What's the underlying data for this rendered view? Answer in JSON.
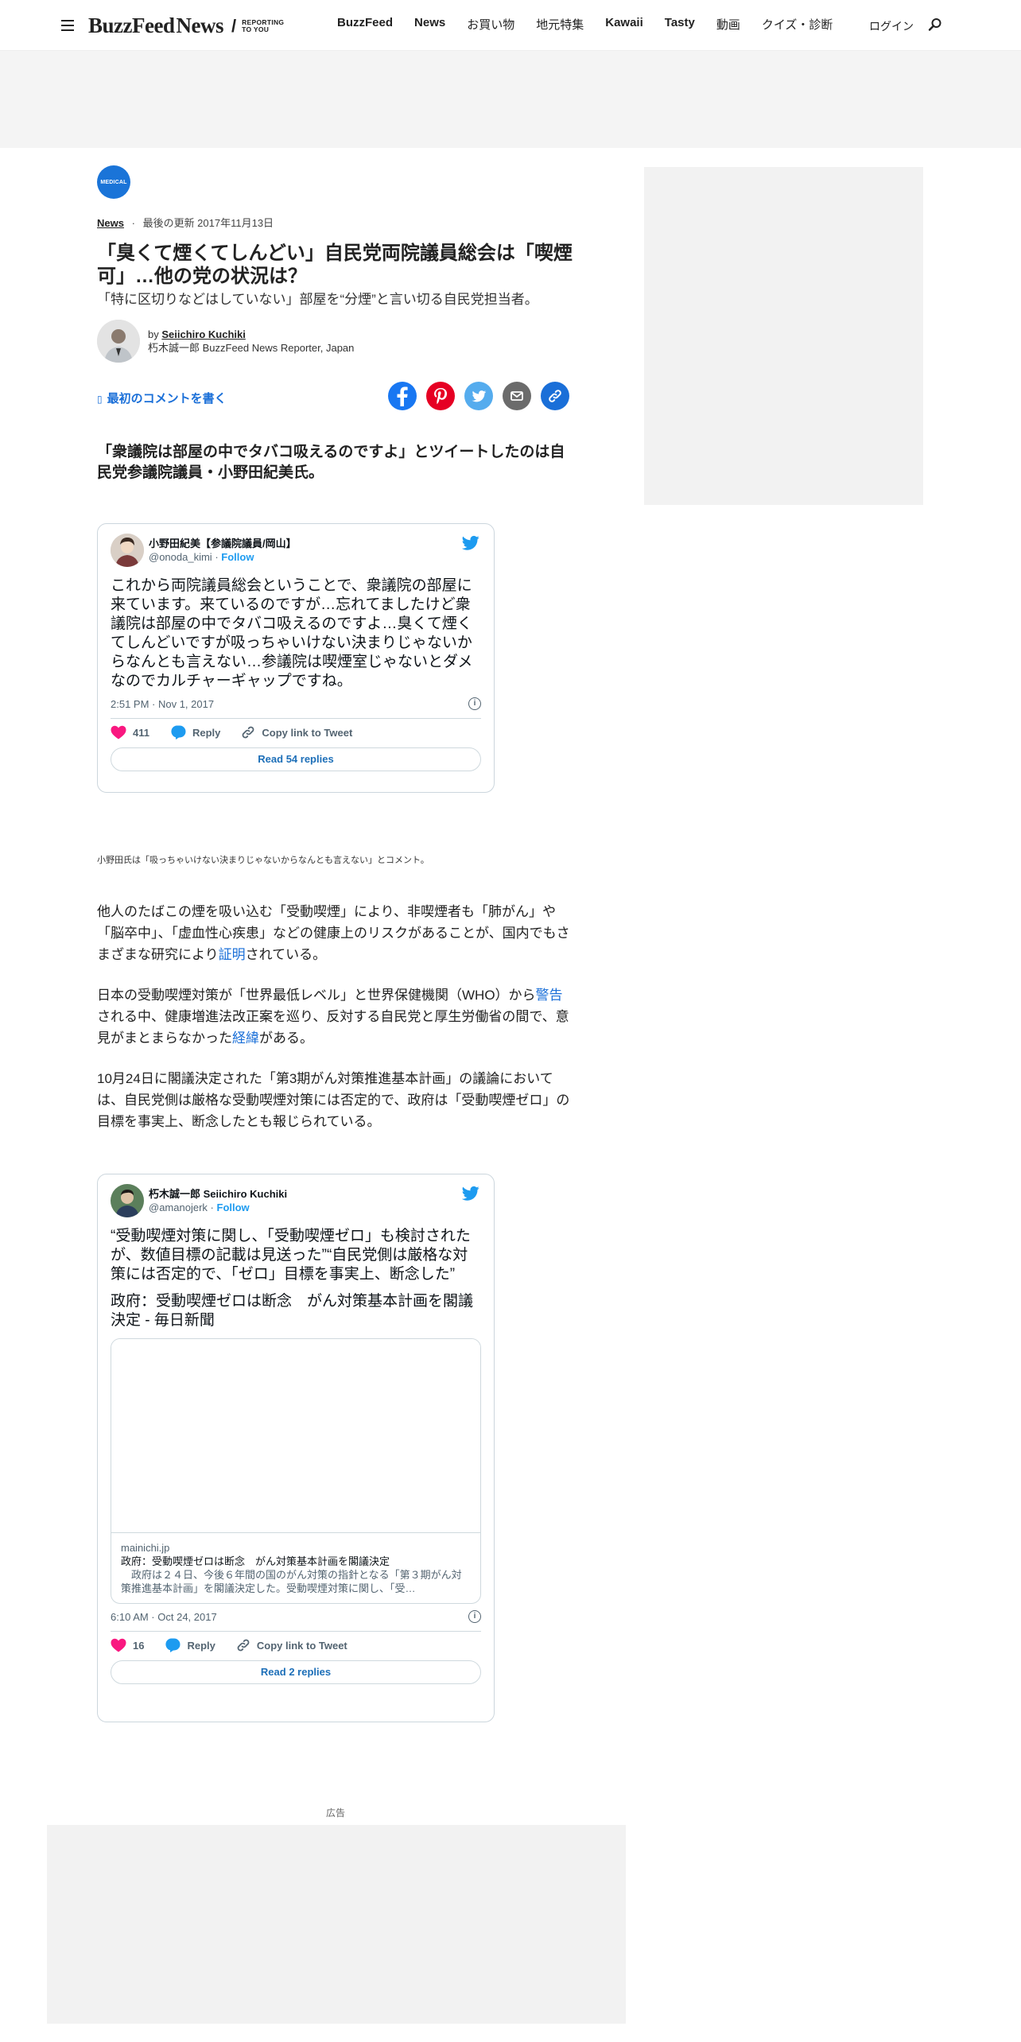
{
  "header": {
    "logo_main": "BuzzFeed",
    "logo_news": "News",
    "logo_tagline_1": "REPORTING",
    "logo_tagline_2": "TO YOU",
    "nav": [
      "BuzzFeed",
      "News",
      "お買い物",
      "地元特集",
      "Kawaii",
      "Tasty",
      "動画",
      "クイズ・診断"
    ],
    "login": "ログイン"
  },
  "article": {
    "badge": "MEDICAL",
    "category": "News",
    "updated": "最後の更新 2017年11月13日",
    "title": "「臭くて煙くてしんどい」自民党両院議員総会は「喫煙可」…他の党の状況は？",
    "dek": "「特に区切りなどはしていない」部屋を“分煙”と言い切る自民党担当者。",
    "byline_prefix": "by",
    "author": "Seiichiro Kuchiki",
    "author_title": "朽木誠一郎 BuzzFeed News Reporter, Japan",
    "comment_link": "最初のコメントを書く",
    "subheading": "「衆議院は部屋の中でタバコ吸えるのですよ」とツイートしたのは自民党参議院議員・小野田紀美氏。",
    "caption": "小野田氏は「吸っちゃいけない決まりじゃないからなんとも言えない」とコメント。",
    "paragraphs": [
      {
        "before": "他人のたばこの煙を吸い込む「受動喫煙」により、非喫煙者も「肺がん」や「脳卒中」、「虚血性心疾患」などの健康上のリスクがあることが、国内でもさまざまな研究により",
        "link": "証明",
        "after": "されている。"
      },
      {
        "before": "日本の受動喫煙対策が「世界最低レベル」と世界保健機関（WHO）から",
        "link": "警告",
        "middle": "される中、健康増進法改正案を巡り、反対する自民党と厚生労働省の間で、意見がまとまらなかった",
        "link2": "経緯",
        "after": "がある。"
      },
      {
        "text": "10月24日に閣議決定された「第3期がん対策推進基本計画」の議論においては、自民党側は厳格な受動喫煙対策には否定的で、政府は「受動喫煙ゼロ」の目標を事実上、断念したとも報じられている。"
      }
    ]
  },
  "tweets": [
    {
      "name": "小野田紀美【参議院議員/岡山】",
      "handle": "@onoda_kimi",
      "follow": "Follow",
      "text": "これから両院議員総会ということで、衆議院の部屋に来ています。来ているのですが…忘れてましたけど衆議院は部屋の中でタバコ吸えるのですよ…臭くて煙くてしんどいですが吸っちゃいけない決まりじゃないからなんとも言えない…参議院は喫煙室じゃないとダメなのでカルチャーギャップですね。",
      "time": "2:51 PM · Nov 1, 2017",
      "likes": "411",
      "reply": "Reply",
      "copy": "Copy link to Tweet",
      "read": "Read 54 replies"
    },
    {
      "name": "朽木誠一郎 Seiichiro Kuchiki",
      "handle": "@amanojerk",
      "follow": "Follow",
      "text": "“受動喫煙対策に関し、「受動喫煙ゼロ」も検討されたが、数値目標の記載は見送った”“自民党側は厳格な対策には否定的で、「ゼロ」目標を事実上、断念した”",
      "text2": "政府：受動喫煙ゼロは断念　がん対策基本計画を閣議決定 - 毎日新聞",
      "card_domain": "mainichi.jp",
      "card_title": "政府：受動喫煙ゼロは断念　がん対策基本計画を閣議決定",
      "card_desc": "　政府は２４日、今後６年間の国のがん対策の指針となる「第３期がん対策推進基本計画」を閣議決定した。受動喫煙対策に関し、「受…",
      "time": "6:10 AM · Oct 24, 2017",
      "likes": "16",
      "reply": "Reply",
      "copy": "Copy link to Tweet",
      "read": "Read 2 replies"
    }
  ],
  "ad_label": "広告",
  "colors": {
    "accent": "#1a6fd8",
    "twitter": "#1d9bf0",
    "like": "#f91880",
    "ad_bg": "#f2f2f2"
  }
}
